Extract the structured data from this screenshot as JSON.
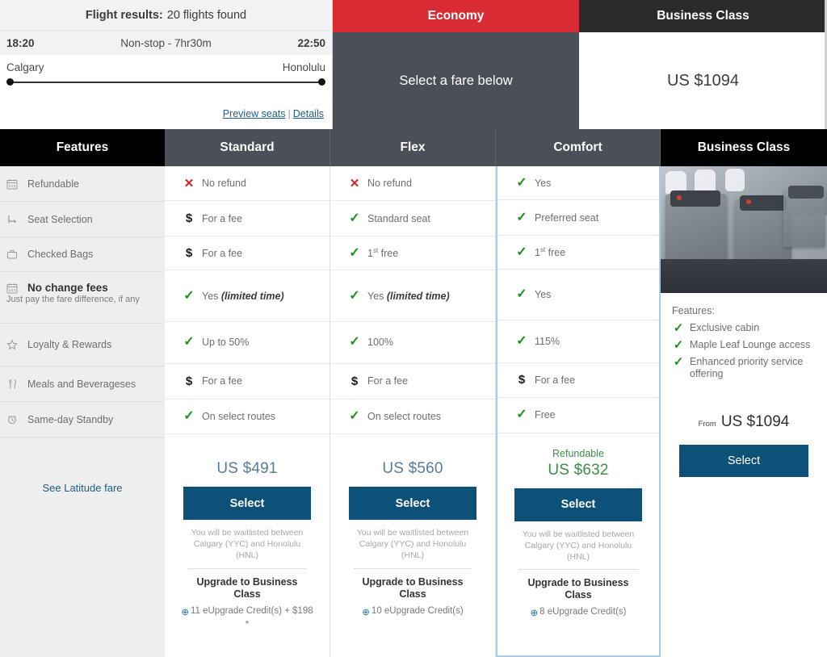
{
  "flight_summary": {
    "results_label": "Flight results:",
    "results_count": "20 flights found",
    "depart_time": "18:20",
    "duration": "Non-stop - 7hr30m",
    "arrive_time": "22:50",
    "origin": "Calgary",
    "destination": "Honolulu",
    "preview_seats_link": "Preview seats",
    "link_separator": "|",
    "details_link": "Details"
  },
  "cabins": {
    "economy": {
      "title": "Economy",
      "message": "Select a fare below",
      "accent_color": "#d92b34"
    },
    "business": {
      "title": "Business Class",
      "price": "US $1094",
      "accent_color": "#2b2b2b"
    }
  },
  "columns": {
    "features_header": "Features",
    "standard_header": "Standard",
    "flex_header": "Flex",
    "comfort_header": "Comfort",
    "business_header": "Business Class",
    "highlight_color": "#a9cde6"
  },
  "features": [
    {
      "icon": "calendar-icon",
      "label": "Refundable"
    },
    {
      "icon": "seat-icon",
      "label": "Seat Selection"
    },
    {
      "icon": "briefcase-icon",
      "label": "Checked Bags"
    },
    {
      "icon": "calendar-icon",
      "label": "No change fees",
      "sublabel": "Just pay the fare difference, if any",
      "emphasis": true
    },
    {
      "icon": "star-icon",
      "label": "Loyalty & Rewards"
    },
    {
      "icon": "utensils-icon",
      "label": "Meals and Beverageses"
    },
    {
      "icon": "clock-icon",
      "label": "Same-day Standby"
    }
  ],
  "fares": [
    {
      "name": "Standard",
      "highlighted": false,
      "cells": [
        {
          "mark": "cross",
          "text": "No refund"
        },
        {
          "mark": "dollar",
          "text": "For a fee"
        },
        {
          "mark": "dollar",
          "text": "For a fee"
        },
        {
          "mark": "check",
          "text": "Yes ",
          "emphasis": "(limited time)"
        },
        {
          "mark": "check",
          "text": "Up to 50%"
        },
        {
          "mark": "dollar",
          "text": "For a fee"
        },
        {
          "mark": "check",
          "text": "On select routes"
        }
      ],
      "refundable_tag": "",
      "price": "US $491",
      "select_label": "Select",
      "waitlist_note": "You will be waitlisted between Calgary (YYC) and Honolulu (HNL)",
      "upgrade_title": "Upgrade to Business Class",
      "upgrade_credits": "11 eUpgrade Credit(s) + $198 *"
    },
    {
      "name": "Flex",
      "highlighted": false,
      "cells": [
        {
          "mark": "cross",
          "text": "No refund"
        },
        {
          "mark": "check",
          "text": "Standard seat"
        },
        {
          "mark": "check",
          "text": "1",
          "sup": "st",
          "text_after": " free"
        },
        {
          "mark": "check",
          "text": "Yes ",
          "emphasis": "(limited time)"
        },
        {
          "mark": "check",
          "text": "100%"
        },
        {
          "mark": "dollar",
          "text": "For a fee"
        },
        {
          "mark": "check",
          "text": "On select routes"
        }
      ],
      "refundable_tag": "",
      "price": "US $560",
      "select_label": "Select",
      "waitlist_note": "You will be waitlisted between Calgary (YYC) and Honolulu (HNL)",
      "upgrade_title": "Upgrade to Business Class",
      "upgrade_credits": "10 eUpgrade Credit(s)"
    },
    {
      "name": "Comfort",
      "highlighted": true,
      "cells": [
        {
          "mark": "check",
          "text": "Yes"
        },
        {
          "mark": "check",
          "text": "Preferred seat"
        },
        {
          "mark": "check",
          "text": "1",
          "sup": "st",
          "text_after": " free"
        },
        {
          "mark": "check",
          "text": "Yes"
        },
        {
          "mark": "check",
          "text": "115%"
        },
        {
          "mark": "dollar",
          "text": "For a fee"
        },
        {
          "mark": "check",
          "text": "Free"
        }
      ],
      "refundable_tag": "Refundable",
      "price": "US $632",
      "select_label": "Select",
      "waitlist_note": "You will be waitlisted between Calgary (YYC) and Honolulu (HNL)",
      "upgrade_title": "Upgrade to Business Class",
      "upgrade_credits": "8 eUpgrade Credit(s)"
    }
  ],
  "business_column": {
    "features_label": "Features:",
    "feature_items": [
      "Exclusive cabin",
      "Maple Leaf Lounge access",
      "Enhanced priority service offering"
    ],
    "from_label": "From",
    "price": "US  $1094",
    "select_label": "Select"
  },
  "footer_left": {
    "latitude_link": "See Latitude fare"
  },
  "marks": {
    "check": "✓",
    "cross": "✕",
    "dollar": "$",
    "upgrade_circle": "⊕"
  }
}
